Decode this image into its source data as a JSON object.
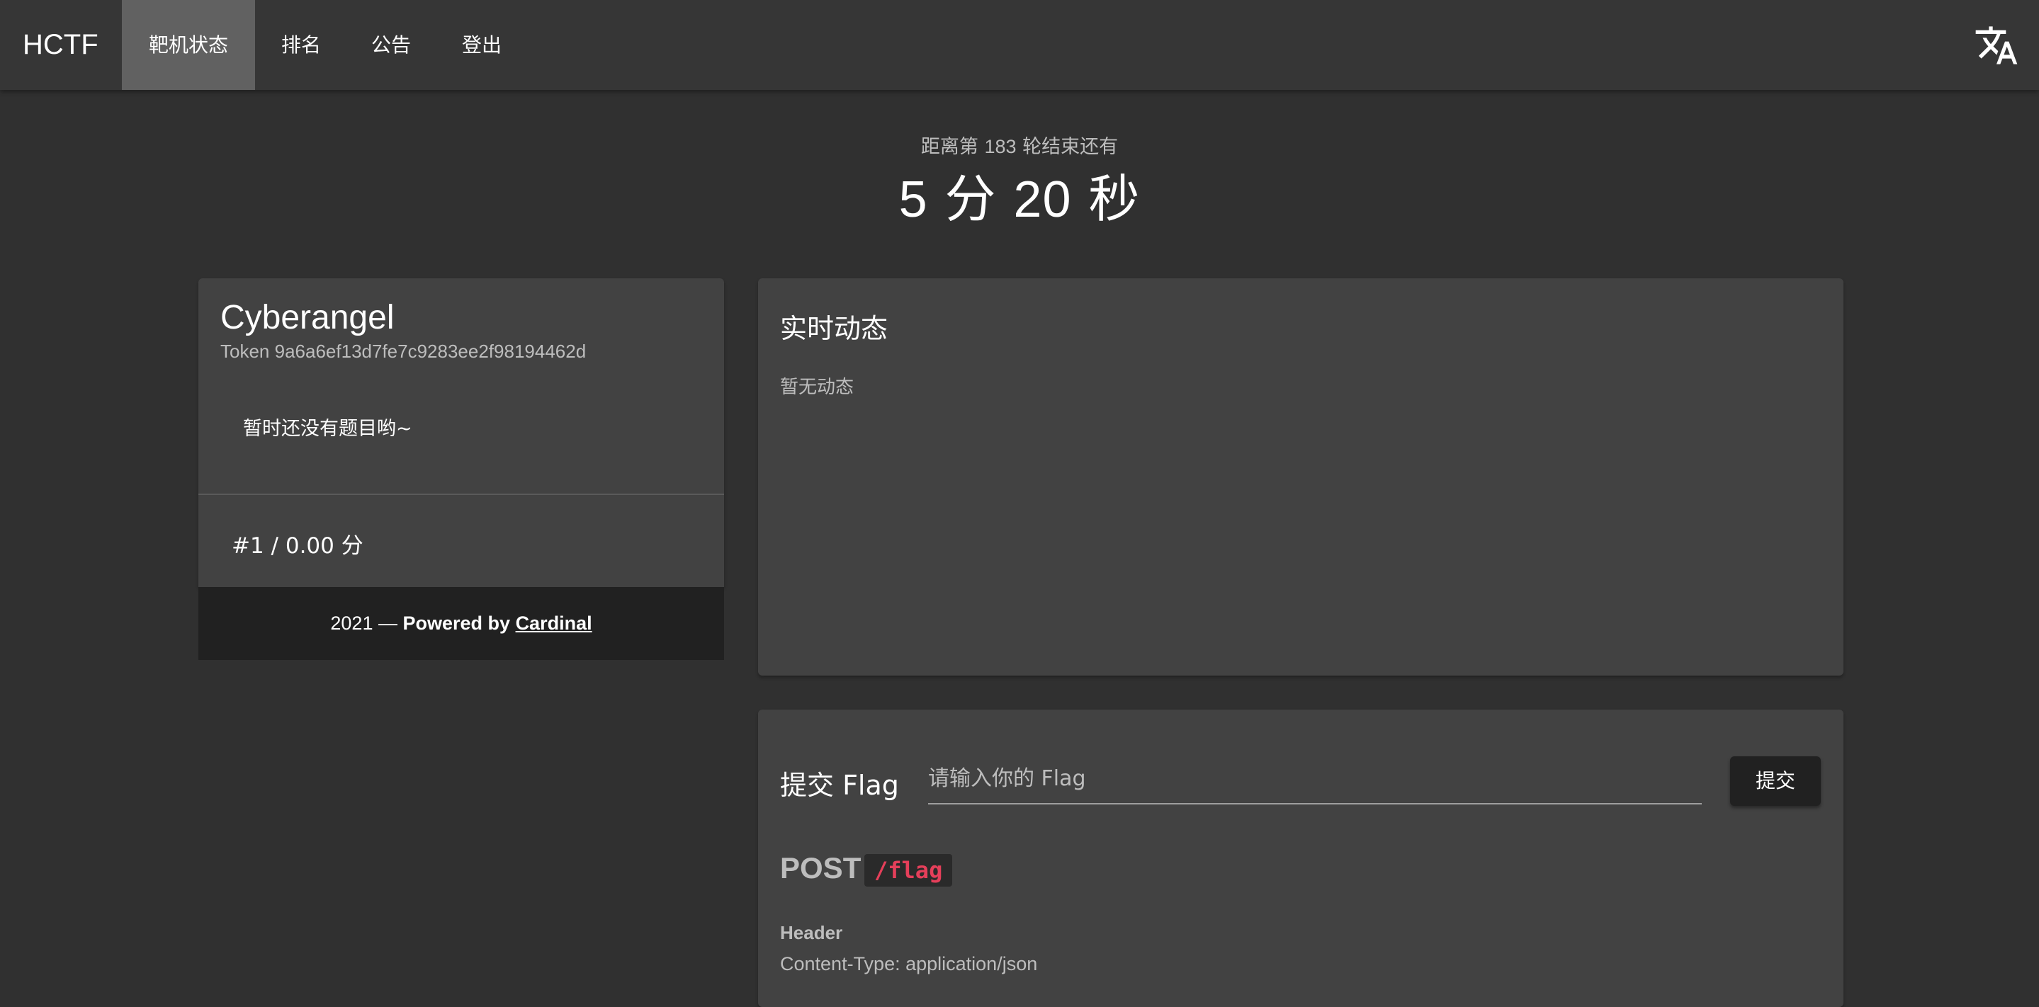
{
  "app": {
    "brand": "HCTF"
  },
  "nav": {
    "tabs": [
      {
        "label": "靶机状态",
        "active": true
      },
      {
        "label": "排名",
        "active": false
      },
      {
        "label": "公告",
        "active": false
      },
      {
        "label": "登出",
        "active": false
      }
    ],
    "translate_icon": "translate-icon"
  },
  "round": {
    "prefix": "距离第",
    "number": "183",
    "suffix": "轮结束还有",
    "minutes": "5",
    "minutes_unit": "分",
    "seconds": "20",
    "seconds_unit": "秒"
  },
  "team": {
    "name": "Cyberangel",
    "token_label": "Token",
    "token": "9a6a6ef13d7fe7c9283ee2f98194462d",
    "no_challenges": "暂时还没有题目哟~",
    "rank_score": "#1 / 0.00 分"
  },
  "footer": {
    "year": "2021",
    "dash": "—",
    "powered_by": "Powered by",
    "link": "Cardinal"
  },
  "live": {
    "title": "实时动态",
    "empty": "暂无动态"
  },
  "flag": {
    "title": "提交 Flag",
    "placeholder": "请输入你的 Flag",
    "value": "",
    "submit_label": "提交",
    "api": {
      "method": "POST",
      "path": "/flag",
      "header_label": "Header",
      "header_value": "Content-Type: application/json"
    }
  },
  "colors": {
    "background": "#303030",
    "appbar": "#363636",
    "active_tab": "#616161",
    "card": "#424242",
    "footer": "#212121",
    "code_path": "#e53f5a"
  }
}
